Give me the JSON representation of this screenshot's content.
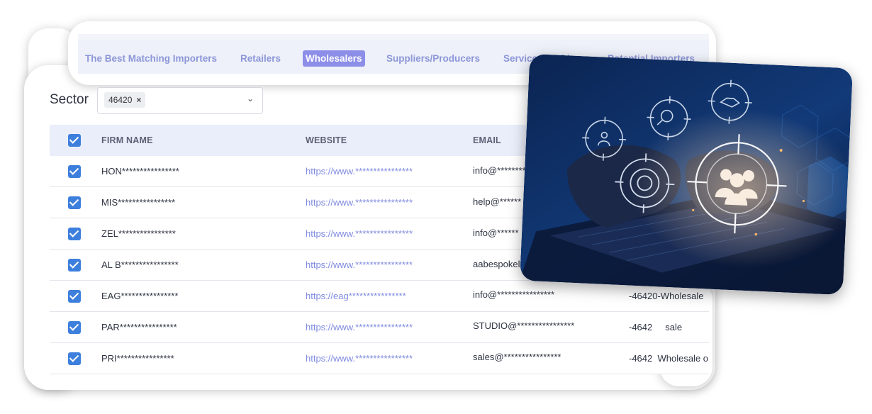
{
  "tabs": [
    {
      "label": "The Best Matching Importers",
      "active": false
    },
    {
      "label": "Retailers",
      "active": false
    },
    {
      "label": "Wholesalers",
      "active": true
    },
    {
      "label": "Suppliers/Producers",
      "active": false
    },
    {
      "label": "Service Providers",
      "active": false
    },
    {
      "label": "Potential Importers",
      "active": false
    }
  ],
  "sector": {
    "label": "Sector",
    "chip": "46420",
    "chip_remove": "×",
    "chevron": "⌄"
  },
  "table": {
    "headers": {
      "firm": "FIRM NAME",
      "website": "WEBSITE",
      "email": "EMAIL"
    },
    "rows": [
      {
        "firm": "HON****************",
        "website": "https://www.****************",
        "email": "info@********",
        "extra": ""
      },
      {
        "firm": "MIS****************",
        "website": "https://www.****************",
        "email": "help@******",
        "extra": ""
      },
      {
        "firm": "ZEL****************",
        "website": "https://www.****************",
        "email": "info@******",
        "extra": ""
      },
      {
        "firm": "AL B****************",
        "website": "https://www.****************",
        "email": "aabespokelt",
        "extra": ""
      },
      {
        "firm": "EAG****************",
        "website": "https://eag****************",
        "email": "info@****************",
        "extra": "-46420-Wholesale"
      },
      {
        "firm": "PAR****************",
        "website": "https://www.****************",
        "email": "STUDIO@****************",
        "extra": "-4642     sale"
      },
      {
        "firm": "PRI****************",
        "website": "https://www.****************",
        "email": "sales@****************",
        "extra": "-4642  Wholesale o"
      }
    ]
  },
  "colors": {
    "accent": "#8c8ee8",
    "tab_text": "#8c96d8",
    "checkbox": "#3d7fdc",
    "link": "#7f8be0",
    "header_bg": "#eaeefa"
  }
}
